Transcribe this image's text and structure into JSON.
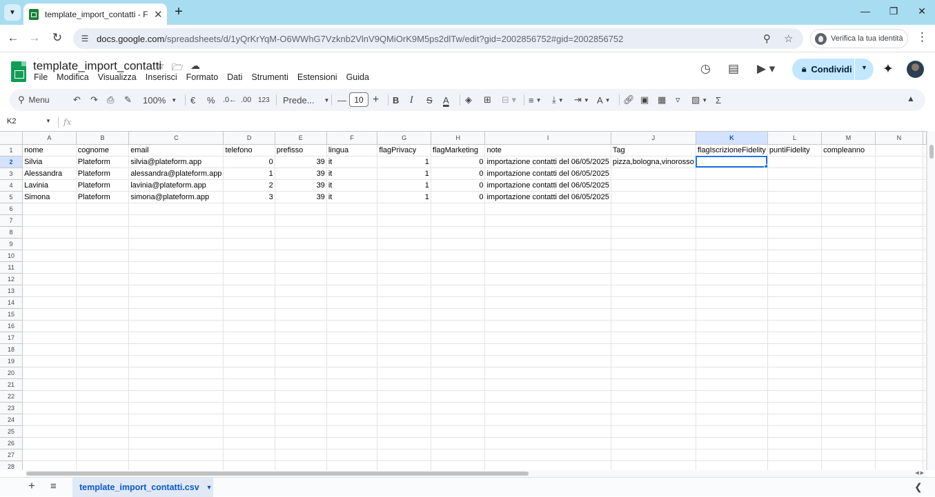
{
  "browser": {
    "tab_title": "template_import_contatti - Fogli Google",
    "new_tab_icon": "+",
    "url_host": "docs.google.com",
    "url_path": "/spreadsheets/d/1yQrKrYqM-O6WWhG7Vzknb2VlnV9QMiOrK9M5ps2dlTw/edit?gid=2002856752#gid=2002856752",
    "profile_label": "Verifica la tua identità"
  },
  "doc": {
    "title": "template_import_contatti",
    "menu": [
      "File",
      "Modifica",
      "Visualizza",
      "Inserisci",
      "Formato",
      "Dati",
      "Strumenti",
      "Estensioni",
      "Guida"
    ],
    "share_label": "Condividi"
  },
  "toolbar": {
    "menu_label": "Menu",
    "zoom": "100%",
    "currency": "€",
    "percent": "%",
    "dec_decrease": ".0←",
    "dec_increase": ".00",
    "format_123": "123",
    "font": "Prede...",
    "font_size": "10"
  },
  "formula_bar": {
    "cell_ref": "K2",
    "fx": "fx"
  },
  "grid": {
    "columns": [
      "A",
      "B",
      "C",
      "D",
      "E",
      "F",
      "G",
      "H",
      "I",
      "J",
      "K",
      "L",
      "M",
      "N"
    ],
    "selected_column": "K",
    "selected_row": 2,
    "row_count": 28,
    "rows": [
      [
        "nome",
        "cognome",
        "email",
        "telefono",
        "prefisso",
        "lingua",
        "flagPrivacy",
        "flagMarketing",
        "note",
        "Tag",
        "flagIscrizioneFidelity",
        "puntiFidelity",
        "compleanno",
        ""
      ],
      [
        "Silvia",
        "Plateform",
        "silvia@plateform.app",
        "0",
        "39",
        "it",
        "1",
        "0",
        "importazione contatti del 06/05/2025",
        "pizza,bologna,vinorosso",
        "",
        "",
        "",
        ""
      ],
      [
        "Alessandra",
        "Plateform",
        "alessandra@plateform.app",
        "1",
        "39",
        "it",
        "1",
        "0",
        "importazione contatti del 06/05/2025",
        "",
        "",
        "",
        "",
        ""
      ],
      [
        "Lavinia",
        "Plateform",
        "lavinia@plateform.app",
        "2",
        "39",
        "it",
        "1",
        "0",
        "importazione contatti del 06/05/2025",
        "",
        "",
        "",
        "",
        ""
      ],
      [
        "Simona",
        "Plateform",
        "simona@plateform.app",
        "3",
        "39",
        "it",
        "1",
        "0",
        "importazione contatti del 06/05/2025",
        "",
        "",
        "",
        "",
        ""
      ]
    ]
  },
  "sheets": {
    "active_sheet": "template_import_contatti.csv"
  }
}
